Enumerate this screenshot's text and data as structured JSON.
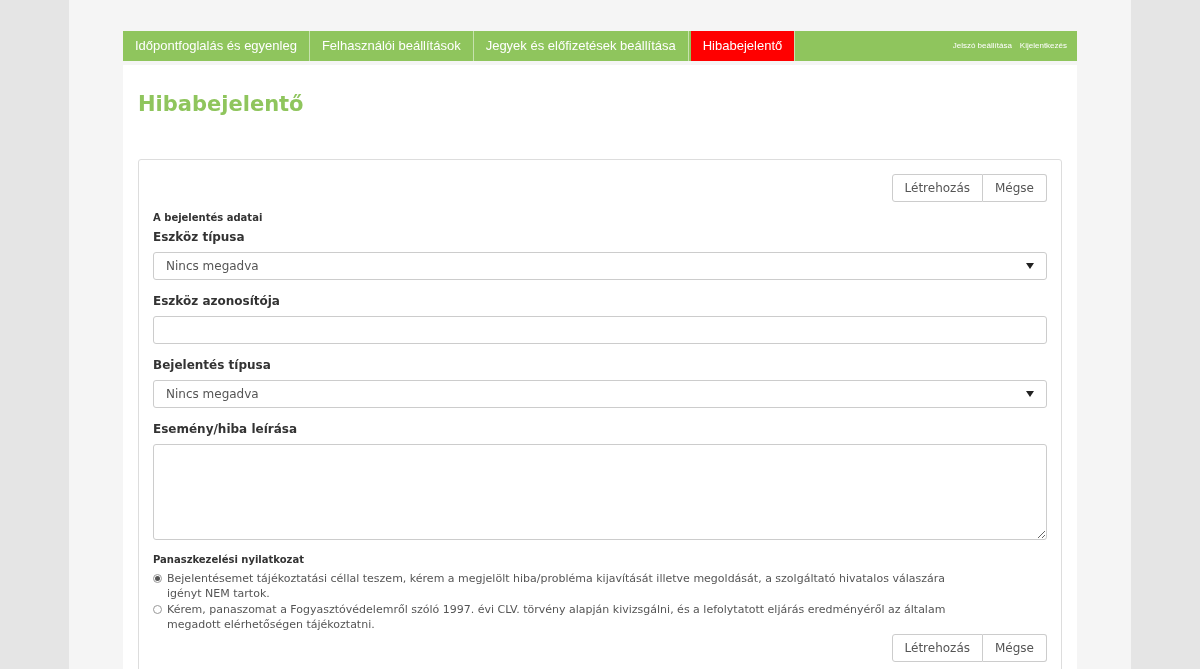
{
  "nav": {
    "tabs": [
      {
        "label": "Időpontfoglalás és egyenleg",
        "selected": false
      },
      {
        "label": "Felhasználói beállítások",
        "selected": false
      },
      {
        "label": "Jegyek és előfizetések beállítása",
        "selected": false
      },
      {
        "label": "Hibabejelentő",
        "selected": true
      }
    ],
    "links": [
      "Jelszó beállítása",
      "Kijelentkezés"
    ]
  },
  "page_title": "Hibabejelentő",
  "form": {
    "buttons_top": [
      "Létrehozás",
      "Mégse"
    ],
    "section_label": "A bejelentés adatai",
    "fields": [
      {
        "kind": "select",
        "label": "Eszköz típusa",
        "value": "Nincs megadva"
      },
      {
        "kind": "text",
        "label": "Eszköz azonosítója"
      },
      {
        "kind": "select",
        "label": "Bejelentés típusa",
        "value": "Nincs megadva"
      },
      {
        "kind": "textarea",
        "label": "Esemény/hiba leírása"
      }
    ],
    "statement": {
      "label": "Panaszkezelési nyilatkozat",
      "options": [
        {
          "text": "Bejelentésemet tájékoztatási céllal teszem, kérem a megjelölt hiba/probléma kijavítását illetve megoldását, a szolgáltató hivatalos válaszára igényt NEM tartok.",
          "selected": true
        },
        {
          "text": "Kérem, panaszomat a Fogyasztóvédelemről szóló 1997. évi CLV. törvény alapján kivizsgálni, és a lefolytatott eljárás eredményéről az általam megadott elérhetőségen tájékoztatni.",
          "selected": false
        }
      ]
    },
    "buttons_bottom": [
      "Létrehozás",
      "Mégse"
    ]
  }
}
